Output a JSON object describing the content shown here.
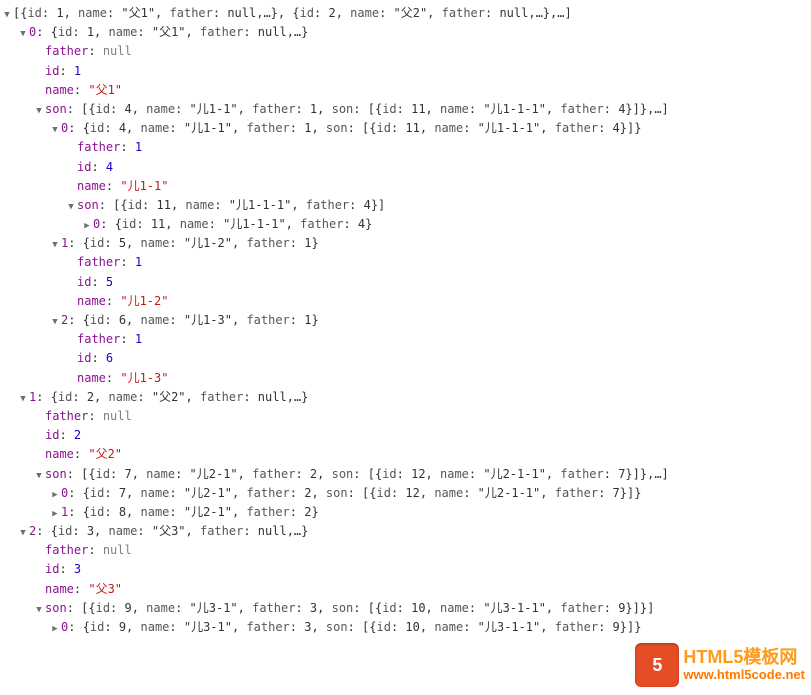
{
  "glyph_open": "▼",
  "glyph_closed": "▶",
  "rows": [
    {
      "depth": 0,
      "arrow": "open",
      "html": "<span class='obj preview'>[{<span class='key'>id</span>: 1, <span class='key'>name</span>: \"父1\", <span class='key'>father</span>: null,…}, {<span class='key'>id</span>: 2, <span class='key'>name</span>: \"父2\", <span class='key'>father</span>: null,…},…]</span>"
    },
    {
      "depth": 1,
      "arrow": "open",
      "html": "<span class='key'>0</span>: <span class='obj preview'>{<span class='key'>id</span>: 1, <span class='key'>name</span>: \"父1\", <span class='key'>father</span>: null,…}</span>"
    },
    {
      "depth": 2,
      "arrow": "none",
      "html": "<span class='key'>father</span>: <span class='null'>null</span>"
    },
    {
      "depth": 2,
      "arrow": "none",
      "html": "<span class='key'>id</span>: <span class='num'>1</span>"
    },
    {
      "depth": 2,
      "arrow": "none",
      "html": "<span class='key'>name</span>: <span class='str'>\"父1\"</span>"
    },
    {
      "depth": 2,
      "arrow": "open",
      "html": "<span class='key'>son</span>: <span class='obj preview'>[{<span class='key'>id</span>: 4, <span class='key'>name</span>: \"儿1-1\", <span class='key'>father</span>: 1, <span class='key'>son</span>: [{<span class='key'>id</span>: 11, <span class='key'>name</span>: \"儿1-1-1\", <span class='key'>father</span>: 4}]},…]</span>"
    },
    {
      "depth": 3,
      "arrow": "open",
      "html": "<span class='key'>0</span>: <span class='obj preview'>{<span class='key'>id</span>: 4, <span class='key'>name</span>: \"儿1-1\", <span class='key'>father</span>: 1, <span class='key'>son</span>: [{<span class='key'>id</span>: 11, <span class='key'>name</span>: \"儿1-1-1\", <span class='key'>father</span>: 4}]}</span>"
    },
    {
      "depth": 4,
      "arrow": "none",
      "html": "<span class='key'>father</span>: <span class='num'>1</span>"
    },
    {
      "depth": 4,
      "arrow": "none",
      "html": "<span class='key'>id</span>: <span class='num'>4</span>"
    },
    {
      "depth": 4,
      "arrow": "none",
      "html": "<span class='key'>name</span>: <span class='str'>\"儿1-1\"</span>"
    },
    {
      "depth": 4,
      "arrow": "open",
      "html": "<span class='key'>son</span>: <span class='obj preview'>[{<span class='key'>id</span>: 11, <span class='key'>name</span>: \"儿1-1-1\", <span class='key'>father</span>: 4}]</span>"
    },
    {
      "depth": 5,
      "arrow": "closed",
      "html": "<span class='key'>0</span>: <span class='obj preview'>{<span class='key'>id</span>: 11, <span class='key'>name</span>: \"儿1-1-1\", <span class='key'>father</span>: 4}</span>"
    },
    {
      "depth": 3,
      "arrow": "open",
      "html": "<span class='key'>1</span>: <span class='obj preview'>{<span class='key'>id</span>: 5, <span class='key'>name</span>: \"儿1-2\", <span class='key'>father</span>: 1}</span>"
    },
    {
      "depth": 4,
      "arrow": "none",
      "html": "<span class='key'>father</span>: <span class='num'>1</span>"
    },
    {
      "depth": 4,
      "arrow": "none",
      "html": "<span class='key'>id</span>: <span class='num'>5</span>"
    },
    {
      "depth": 4,
      "arrow": "none",
      "html": "<span class='key'>name</span>: <span class='str'>\"儿1-2\"</span>"
    },
    {
      "depth": 3,
      "arrow": "open",
      "html": "<span class='key'>2</span>: <span class='obj preview'>{<span class='key'>id</span>: 6, <span class='key'>name</span>: \"儿1-3\", <span class='key'>father</span>: 1}</span>"
    },
    {
      "depth": 4,
      "arrow": "none",
      "html": "<span class='key'>father</span>: <span class='num'>1</span>"
    },
    {
      "depth": 4,
      "arrow": "none",
      "html": "<span class='key'>id</span>: <span class='num'>6</span>"
    },
    {
      "depth": 4,
      "arrow": "none",
      "html": "<span class='key'>name</span>: <span class='str'>\"儿1-3\"</span>"
    },
    {
      "depth": 1,
      "arrow": "open",
      "html": "<span class='key'>1</span>: <span class='obj preview'>{<span class='key'>id</span>: 2, <span class='key'>name</span>: \"父2\", <span class='key'>father</span>: null,…}</span>"
    },
    {
      "depth": 2,
      "arrow": "none",
      "html": "<span class='key'>father</span>: <span class='null'>null</span>"
    },
    {
      "depth": 2,
      "arrow": "none",
      "html": "<span class='key'>id</span>: <span class='num'>2</span>"
    },
    {
      "depth": 2,
      "arrow": "none",
      "html": "<span class='key'>name</span>: <span class='str'>\"父2\"</span>"
    },
    {
      "depth": 2,
      "arrow": "open",
      "html": "<span class='key'>son</span>: <span class='obj preview'>[{<span class='key'>id</span>: 7, <span class='key'>name</span>: \"儿2-1\", <span class='key'>father</span>: 2, <span class='key'>son</span>: [{<span class='key'>id</span>: 12, <span class='key'>name</span>: \"儿2-1-1\", <span class='key'>father</span>: 7}]},…]</span>"
    },
    {
      "depth": 3,
      "arrow": "closed",
      "html": "<span class='key'>0</span>: <span class='obj preview'>{<span class='key'>id</span>: 7, <span class='key'>name</span>: \"儿2-1\", <span class='key'>father</span>: 2, <span class='key'>son</span>: [{<span class='key'>id</span>: 12, <span class='key'>name</span>: \"儿2-1-1\", <span class='key'>father</span>: 7}]}</span>"
    },
    {
      "depth": 3,
      "arrow": "closed",
      "html": "<span class='key'>1</span>: <span class='obj preview'>{<span class='key'>id</span>: 8, <span class='key'>name</span>: \"儿2-1\", <span class='key'>father</span>: 2}</span>"
    },
    {
      "depth": 1,
      "arrow": "open",
      "html": "<span class='key'>2</span>: <span class='obj preview'>{<span class='key'>id</span>: 3, <span class='key'>name</span>: \"父3\", <span class='key'>father</span>: null,…}</span>"
    },
    {
      "depth": 2,
      "arrow": "none",
      "html": "<span class='key'>father</span>: <span class='null'>null</span>"
    },
    {
      "depth": 2,
      "arrow": "none",
      "html": "<span class='key'>id</span>: <span class='num'>3</span>"
    },
    {
      "depth": 2,
      "arrow": "none",
      "html": "<span class='key'>name</span>: <span class='str'>\"父3\"</span>"
    },
    {
      "depth": 2,
      "arrow": "open",
      "html": "<span class='key'>son</span>: <span class='obj preview'>[{<span class='key'>id</span>: 9, <span class='key'>name</span>: \"儿3-1\", <span class='key'>father</span>: 3, <span class='key'>son</span>: [{<span class='key'>id</span>: 10, <span class='key'>name</span>: \"儿3-1-1\", <span class='key'>father</span>: 9}]}]</span>"
    },
    {
      "depth": 3,
      "arrow": "closed",
      "html": "<span class='key'>0</span>: <span class='obj preview'>{<span class='key'>id</span>: 9, <span class='key'>name</span>: \"儿3-1\", <span class='key'>father</span>: 3, <span class='key'>son</span>: [{<span class='key'>id</span>: 10, <span class='key'>name</span>: \"儿3-1-1\", <span class='key'>father</span>: 9}]}</span>"
    }
  ],
  "watermark": {
    "badge": "5",
    "line1": "HTML5模板网",
    "line2": "www.html5code.net"
  }
}
